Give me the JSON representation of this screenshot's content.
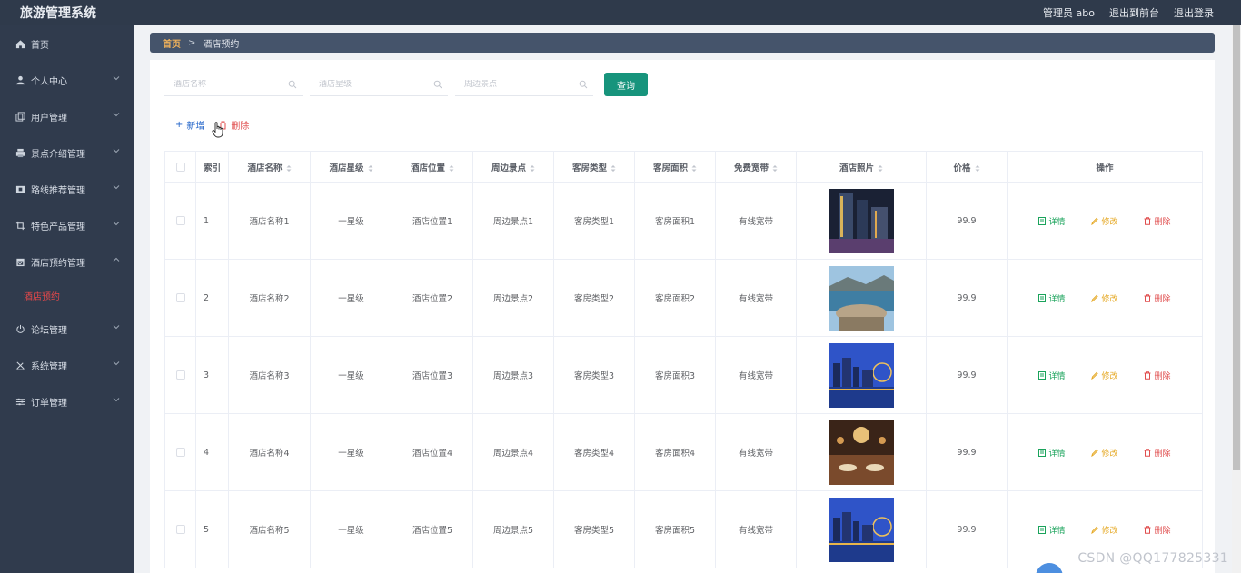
{
  "header": {
    "title": "旅游管理系统",
    "user": "管理员 abo",
    "back_front": "退出到前台",
    "logout": "退出登录"
  },
  "sidebar": {
    "items": [
      {
        "label": "首页",
        "icon": "home-icon"
      },
      {
        "label": "个人中心",
        "icon": "user-icon"
      },
      {
        "label": "用户管理",
        "icon": "copy-icon"
      },
      {
        "label": "景点介绍管理",
        "icon": "printer-icon"
      },
      {
        "label": "路线推荐管理",
        "icon": "film-icon"
      },
      {
        "label": "特色产品管理",
        "icon": "crop-icon"
      },
      {
        "label": "酒店预约管理",
        "icon": "calendar-icon"
      },
      {
        "label": "论坛管理",
        "icon": "power-icon"
      },
      {
        "label": "系统管理",
        "icon": "tools-icon"
      },
      {
        "label": "订单管理",
        "icon": "sliders-icon"
      }
    ],
    "active_sub": "酒店预约"
  },
  "breadcrumb": {
    "home": "首页",
    "current": "酒店预约"
  },
  "search": {
    "name_placeholder": "酒店名称",
    "star_placeholder": "酒店星级",
    "spot_placeholder": "周边景点",
    "query_label": "查询"
  },
  "actions": {
    "add_label": "新增",
    "delete_label": "删除"
  },
  "table": {
    "headers": [
      "索引",
      "酒店名称",
      "酒店星级",
      "酒店位置",
      "周边景点",
      "客房类型",
      "客房面积",
      "免费宽带",
      "酒店照片",
      "价格",
      "操作"
    ],
    "op_detail": "详情",
    "op_edit": "修改",
    "op_delete": "删除",
    "rows": [
      {
        "index": "1",
        "name": "酒店名称1",
        "star": "一星级",
        "location": "酒店位置1",
        "spot": "周边景点1",
        "room_type": "客房类型1",
        "area": "客房面积1",
        "wifi": "有线宽带",
        "price": "99.9",
        "photo": "night-tower"
      },
      {
        "index": "2",
        "name": "酒店名称2",
        "star": "一星级",
        "location": "酒店位置2",
        "spot": "周边景点2",
        "room_type": "客房类型2",
        "area": "客房面积2",
        "wifi": "有线宽带",
        "price": "99.9",
        "photo": "seaside-resort"
      },
      {
        "index": "3",
        "name": "酒店名称3",
        "star": "一星级",
        "location": "酒店位置3",
        "spot": "周边景点3",
        "room_type": "客房类型3",
        "area": "客房面积3",
        "wifi": "有线宽带",
        "price": "99.9",
        "photo": "city-night"
      },
      {
        "index": "4",
        "name": "酒店名称4",
        "star": "一星级",
        "location": "酒店位置4",
        "spot": "周边景点4",
        "room_type": "客房类型4",
        "area": "客房面积4",
        "wifi": "有线宽带",
        "price": "99.9",
        "photo": "banquet-hall"
      },
      {
        "index": "5",
        "name": "酒店名称5",
        "star": "一星级",
        "location": "酒店位置5",
        "spot": "周边景点5",
        "room_type": "客房类型5",
        "area": "客房面积5",
        "wifi": "有线宽带",
        "price": "99.9",
        "photo": "city-night"
      }
    ]
  },
  "watermark": "CSDN @QQ177825331",
  "colors": {
    "header": "#2f3a4b",
    "sidebar": "#303b4d",
    "breadcrumb": "#45546b",
    "primary": "#17947c",
    "active_sub": "#e6484a"
  }
}
